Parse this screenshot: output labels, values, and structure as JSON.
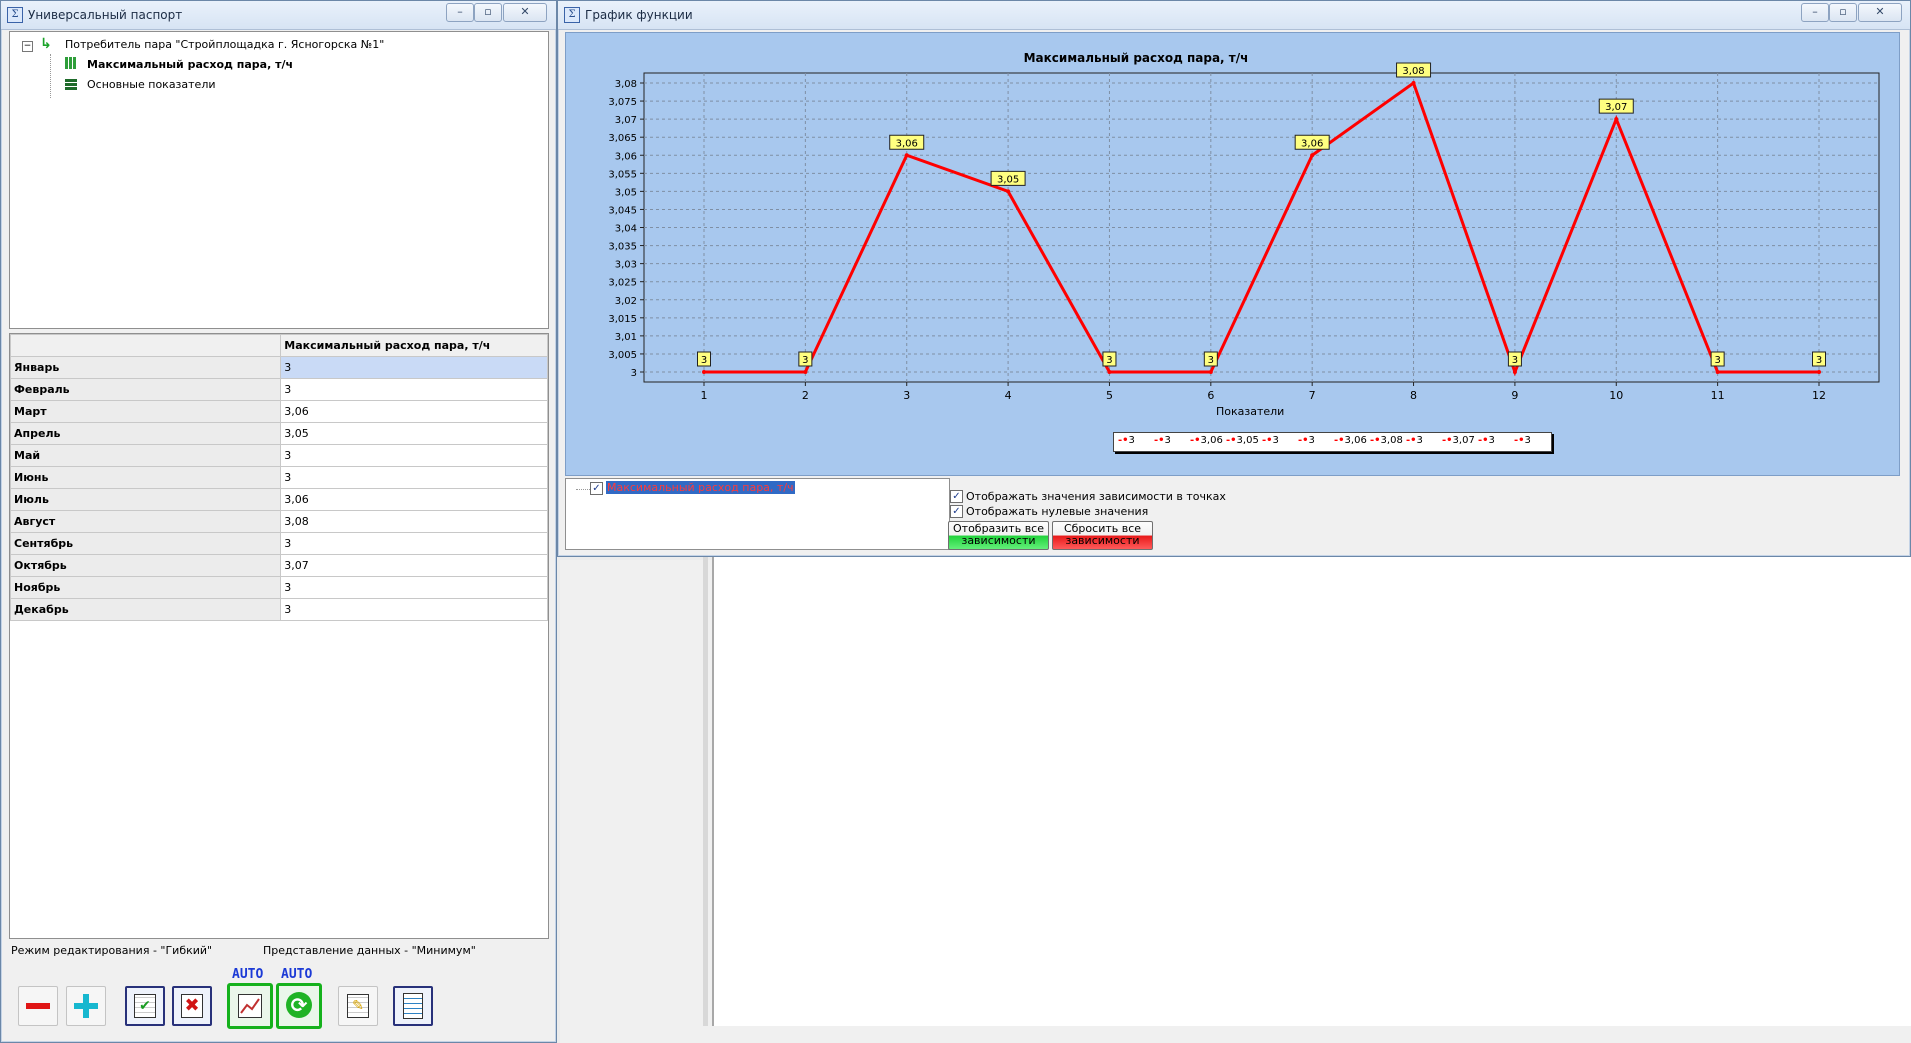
{
  "colors": {
    "series": "#ff0000",
    "plot_bg": "#a8c8ee",
    "label_bg": "#ffff80"
  },
  "left_window": {
    "title": "Универсальный паспорт",
    "tree": {
      "root": "Потребитель пара \"Стройплощадка г. Ясногорска №1\"",
      "child1": "Максимальный расход пара, т/ч",
      "child2": "Основные показатели"
    },
    "table": {
      "column_header": "Максимальный расход пара, т/ч",
      "rows": [
        {
          "label": "Январь",
          "value": "3"
        },
        {
          "label": "Февраль",
          "value": "3"
        },
        {
          "label": "Март",
          "value": "3,06"
        },
        {
          "label": "Апрель",
          "value": "3,05"
        },
        {
          "label": "Май",
          "value": "3"
        },
        {
          "label": "Июнь",
          "value": "3"
        },
        {
          "label": "Июль",
          "value": "3,06"
        },
        {
          "label": "Август",
          "value": "3,08"
        },
        {
          "label": "Сентябрь",
          "value": "3"
        },
        {
          "label": "Октябрь",
          "value": "3,07"
        },
        {
          "label": "Ноябрь",
          "value": "3"
        },
        {
          "label": "Декабрь",
          "value": "3"
        }
      ]
    },
    "status": {
      "edit_mode": "Режим редактирования - \"Гибкий\"",
      "view_mode": "Представление данных - \"Минимум\""
    },
    "toolbar": {
      "auto_label_1": "AUTO",
      "auto_label_2": "AUTO"
    }
  },
  "right_window": {
    "title": "График функции",
    "series_tree_label": "Максимальный расход пара, т/ч",
    "option_show_values": "Отображать значения зависимости в точках",
    "option_show_zero": "Отображать нулевые значения",
    "button_show_all": "Отобразить все зависимости",
    "button_reset_all": "Сбросить все зависимости"
  },
  "chart_data": {
    "type": "line",
    "title": "Максимальный расход пара, т/ч",
    "xlabel": "Показатели",
    "ylabel": "",
    "x": [
      1,
      2,
      3,
      4,
      5,
      6,
      7,
      8,
      9,
      10,
      11,
      12
    ],
    "series": [
      {
        "values": [
          3,
          3,
          3.06,
          3.05,
          3,
          3,
          3.06,
          3.08,
          3,
          3.07,
          3,
          3
        ],
        "labels": [
          "3",
          "3",
          "3,06",
          "3,05",
          "3",
          "3",
          "3,06",
          "3,08",
          "3",
          "3,07",
          "3",
          "3"
        ]
      }
    ],
    "ylim": [
      3,
      3.08
    ],
    "yticks": [
      "3",
      "3,005",
      "3,01",
      "3,015",
      "3,02",
      "3,025",
      "3,03",
      "3,035",
      "3,04",
      "3,045",
      "3,05",
      "3,055",
      "3,06",
      "3,065",
      "3,07",
      "3,075",
      "3,08"
    ],
    "xlim": [
      1,
      12
    ],
    "grid": true,
    "legend_entries": [
      "3",
      "3",
      "3,06",
      "3,05",
      "3",
      "3",
      "3,06",
      "3,08",
      "3",
      "3,07",
      "3",
      "3"
    ],
    "legend_position": "bottom"
  }
}
